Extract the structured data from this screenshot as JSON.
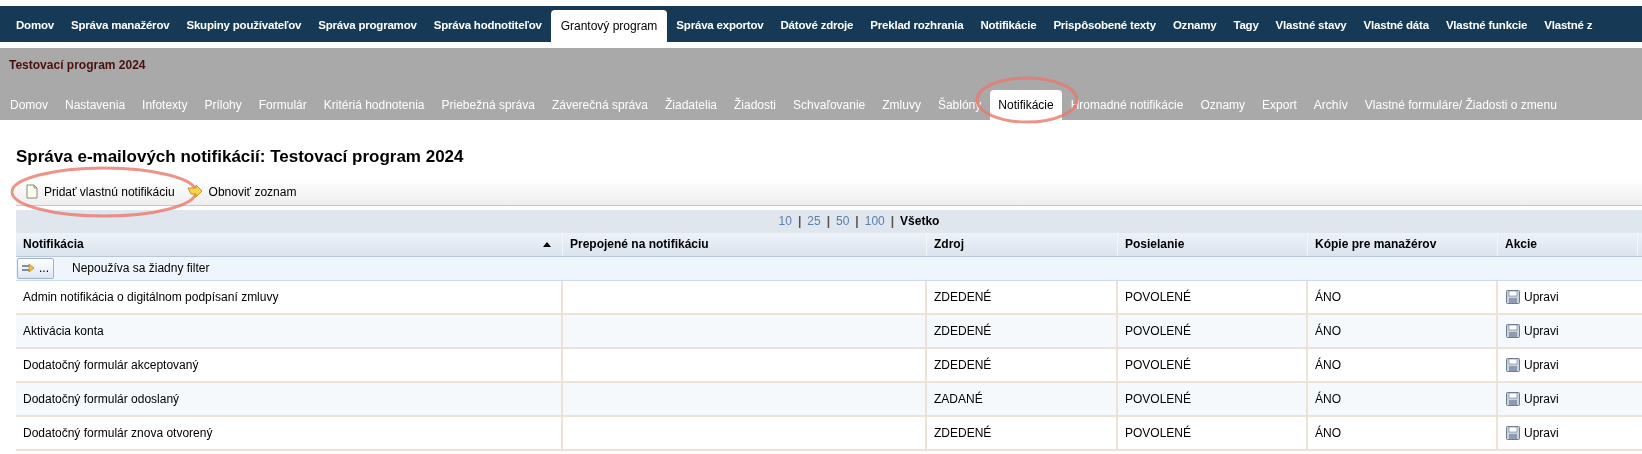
{
  "top_nav": [
    {
      "label": "Domov",
      "selected": false
    },
    {
      "label": "Správa manažérov",
      "selected": false
    },
    {
      "label": "Skupiny používateľov",
      "selected": false
    },
    {
      "label": "Správa programov",
      "selected": false
    },
    {
      "label": "Správa hodnotiteľov",
      "selected": false
    },
    {
      "label": "Grantový program",
      "selected": true
    },
    {
      "label": "Správa exportov",
      "selected": false
    },
    {
      "label": "Dátové zdroje",
      "selected": false
    },
    {
      "label": "Preklad rozhrania",
      "selected": false
    },
    {
      "label": "Notifikácie",
      "selected": false
    },
    {
      "label": "Prispôsobené texty",
      "selected": false
    },
    {
      "label": "Oznamy",
      "selected": false
    },
    {
      "label": "Tagy",
      "selected": false
    },
    {
      "label": "Vlastné stavy",
      "selected": false
    },
    {
      "label": "Vlastné dáta",
      "selected": false
    },
    {
      "label": "Vlastné funkcie",
      "selected": false
    },
    {
      "label": "Vlastné z",
      "selected": false
    }
  ],
  "program_title": "Testovací program 2024",
  "sub_nav": [
    {
      "label": "Domov",
      "selected": false,
      "circled": false
    },
    {
      "label": "Nastavenia",
      "selected": false,
      "circled": false
    },
    {
      "label": "Infotexty",
      "selected": false,
      "circled": false
    },
    {
      "label": "Prílohy",
      "selected": false,
      "circled": false
    },
    {
      "label": "Formulár",
      "selected": false,
      "circled": false
    },
    {
      "label": "Kritériá hodnotenia",
      "selected": false,
      "circled": false
    },
    {
      "label": "Priebežná správa",
      "selected": false,
      "circled": false
    },
    {
      "label": "Záverečná správa",
      "selected": false,
      "circled": false
    },
    {
      "label": "Žiadatelia",
      "selected": false,
      "circled": false
    },
    {
      "label": "Žiadosti",
      "selected": false,
      "circled": false
    },
    {
      "label": "Schvaľovanie",
      "selected": false,
      "circled": false
    },
    {
      "label": "Zmluvy",
      "selected": false,
      "circled": false
    },
    {
      "label": "Šablóny",
      "selected": false,
      "circled": false
    },
    {
      "label": "Notifikácie",
      "selected": true,
      "circled": true
    },
    {
      "label": "Hromadné notifikácie",
      "selected": false,
      "circled": false
    },
    {
      "label": "Oznamy",
      "selected": false,
      "circled": false
    },
    {
      "label": "Export",
      "selected": false,
      "circled": false
    },
    {
      "label": "Archív",
      "selected": false,
      "circled": false
    },
    {
      "label": "Vlastné formuláre/ Žiadosti o zmenu",
      "selected": false,
      "circled": false
    }
  ],
  "heading": "Správa e-mailových notifikácií: Testovací program 2024",
  "toolbar": [
    {
      "kind": "add",
      "label": "Pridať vlastnú notifikáciu",
      "circled": true
    },
    {
      "kind": "refresh",
      "label": "Obnoviť zoznam",
      "circled": false
    }
  ],
  "pager_separator": "|",
  "pager": [
    {
      "label": "10",
      "selected": false
    },
    {
      "label": "25",
      "selected": false
    },
    {
      "label": "50",
      "selected": false
    },
    {
      "label": "100",
      "selected": false
    },
    {
      "label": "Všetko",
      "selected": true
    }
  ],
  "table": {
    "columns": [
      {
        "label": "Notifikácia",
        "sorted": true
      },
      {
        "label": "Prepojené na notifikáciu",
        "sorted": false
      },
      {
        "label": "Zdroj",
        "sorted": false
      },
      {
        "label": "Posielanie",
        "sorted": false
      },
      {
        "label": "Kópie pre manažérov",
        "sorted": false
      },
      {
        "label": "Akcie",
        "sorted": false
      }
    ],
    "filter_button": "...",
    "filter_text": "Nepoužíva sa žiadny filter",
    "rows": [
      {
        "notification": "Admin notifikácia o digitálnom podpísaní zmluvy",
        "source": "ZDEDENÉ",
        "sending": "POVOLENÉ",
        "copies": "ÁNO",
        "action": "Upravi"
      },
      {
        "notification": "Aktivácia konta",
        "source": "ZDEDENÉ",
        "sending": "POVOLENÉ",
        "copies": "ÁNO",
        "action": "Upravi"
      },
      {
        "notification": "Dodatočný formulár akceptovaný",
        "source": "ZDEDENÉ",
        "sending": "POVOLENÉ",
        "copies": "ÁNO",
        "action": "Upravi"
      },
      {
        "notification": "Dodatočný formulár odoslaný",
        "source": "ZADANÉ",
        "sending": "POVOLENÉ",
        "copies": "ÁNO",
        "action": "Upravi"
      },
      {
        "notification": "Dodatočný formulár znova otvorený",
        "source": "ZDEDENÉ",
        "sending": "POVOLENÉ",
        "copies": "ÁNO",
        "action": "Upravi"
      }
    ]
  }
}
